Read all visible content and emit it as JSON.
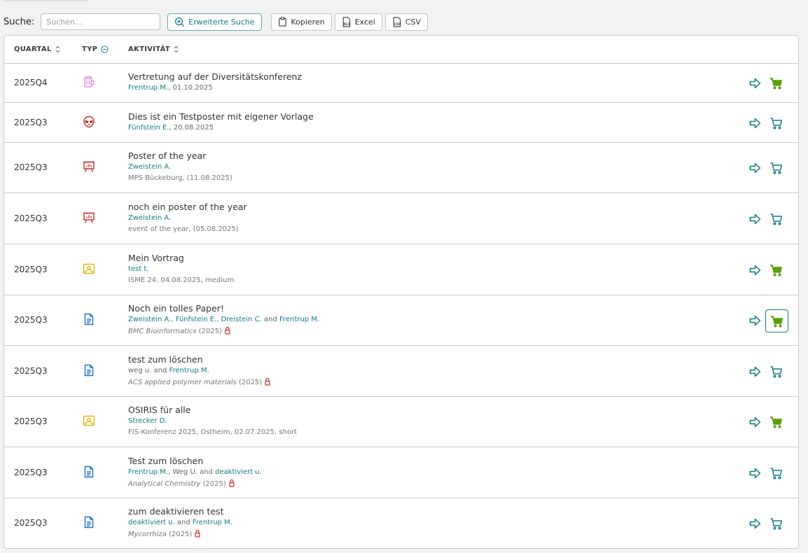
{
  "toolbar": {
    "search_label": "Suche:",
    "search_placeholder": "Suchen...",
    "advanced_search": "Erweiterte Suche",
    "copy": "Kopieren",
    "excel": "Excel",
    "csv": "CSV"
  },
  "columns": {
    "quarter": "QUARTAL",
    "type": "TYP",
    "activity": "AKTIVITÄT"
  },
  "colors": {
    "teal": "#107c84",
    "green": "#5a9f0f",
    "red": "#c42b2b",
    "pink": "#e58ae2",
    "gold": "#e1b80f",
    "blue": "#1d72c2"
  },
  "rows": [
    {
      "quarter": "2025Q4",
      "type_icon": "mug-icon",
      "title": "Vertretung auf der Diversitätskonferenz",
      "authors": [
        {
          "text": "Frentrup M.",
          "link": true
        },
        {
          "text": ", 01.10.2025",
          "link": false
        }
      ],
      "cart_active": true
    },
    {
      "quarter": "2025Q3",
      "type_icon": "alien-icon",
      "title": "Dies ist ein Testposter mit eigener Vorlage",
      "authors": [
        {
          "text": "Fünfstein E.",
          "link": true
        },
        {
          "text": ", 20.08.2025",
          "link": false
        }
      ],
      "cart_active": false
    },
    {
      "quarter": "2025Q3",
      "type_icon": "presentation-chart-icon",
      "title": "Poster of the year",
      "authors": [
        {
          "text": "Zweistein A.",
          "link": true
        }
      ],
      "meta": "MPS Bückeburg, (11.08.2025)",
      "cart_active": false
    },
    {
      "quarter": "2025Q3",
      "type_icon": "presentation-chart-icon",
      "title": "noch ein poster of the year",
      "authors": [
        {
          "text": "Zweistein A.",
          "link": true
        }
      ],
      "meta": "event of the year, (05.08.2025)",
      "cart_active": false
    },
    {
      "quarter": "2025Q3",
      "type_icon": "lecture-icon",
      "title": "Mein Vortrag",
      "authors": [
        {
          "text": "test t.",
          "link": true
        }
      ],
      "meta": "ISME 24. 04.08.2025, medium",
      "cart_active": true
    },
    {
      "quarter": "2025Q3",
      "type_icon": "document-icon",
      "title": "Noch ein tolles Paper!",
      "authors": [
        {
          "text": "Zweistein A.",
          "link": true
        },
        {
          "text": ", ",
          "link": false
        },
        {
          "text": "Fünfstein E.",
          "link": true
        },
        {
          "text": ", ",
          "link": false
        },
        {
          "text": "Dreistein C.",
          "link": true
        },
        {
          "text": " and ",
          "link": false
        },
        {
          "text": "Frentrup M.",
          "link": true
        }
      ],
      "journal": "BMC Bioinformatics",
      "year": " (2025)",
      "locked": true,
      "cart_active": true,
      "cart_focused": true
    },
    {
      "quarter": "2025Q3",
      "type_icon": "document-icon",
      "title": "test zum löschen",
      "authors": [
        {
          "text": "weg u.",
          "link": false
        },
        {
          "text": " and ",
          "link": false
        },
        {
          "text": "Frentrup M.",
          "link": true
        }
      ],
      "journal": "ACS applied polymer materials",
      "year": " (2025)",
      "locked": true,
      "cart_active": false
    },
    {
      "quarter": "2025Q3",
      "type_icon": "lecture-icon",
      "title": "OSIRIS für alle",
      "authors": [
        {
          "text": "Strecker D.",
          "link": true
        }
      ],
      "meta": "FIS-Konferenz 2025, Ostheim, 02.07.2025, short",
      "cart_active": true
    },
    {
      "quarter": "2025Q3",
      "type_icon": "document-icon",
      "title": "Test zum löschen",
      "authors": [
        {
          "text": "Frentrup M.",
          "link": true
        },
        {
          "text": ", Weg U. and ",
          "link": false
        },
        {
          "text": "deaktiviert u.",
          "link": true
        }
      ],
      "journal": "Analytical Chemistry",
      "year": " (2025)",
      "locked": true,
      "cart_active": false
    },
    {
      "quarter": "2025Q3",
      "type_icon": "document-icon",
      "title": "zum deaktivieren test",
      "authors": [
        {
          "text": "deaktiviert u.",
          "link": true
        },
        {
          "text": " and ",
          "link": false
        },
        {
          "text": "Frentrup M.",
          "link": true
        }
      ],
      "journal": "Mycorrhiza",
      "year": " (2025)",
      "locked": true,
      "cart_active": false
    }
  ]
}
